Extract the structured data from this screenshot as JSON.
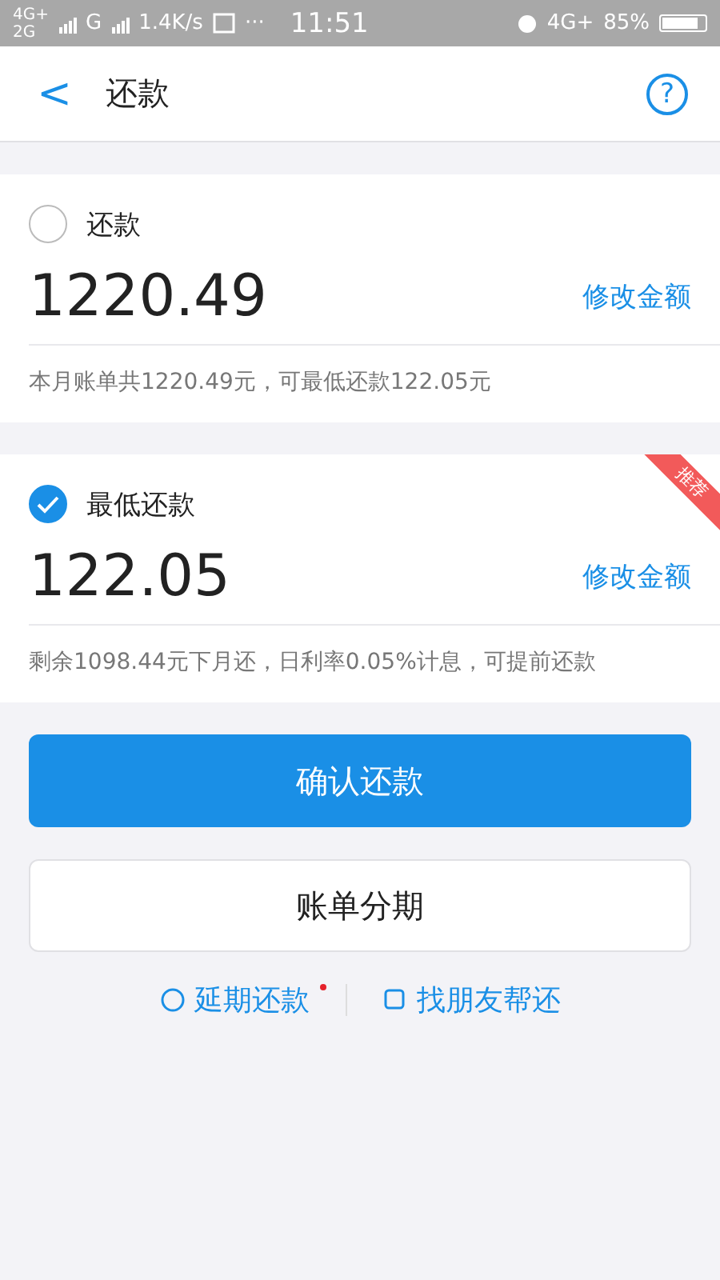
{
  "status_bar": {
    "network_1": "4G+",
    "network_2": "2G",
    "network_3": "G",
    "speed": "1.4K/s",
    "more": "···",
    "time": "11:51",
    "network_right": "4G+",
    "battery": "85%"
  },
  "header": {
    "back": "<",
    "title": "还款",
    "help": "?"
  },
  "options": [
    {
      "label": "还款",
      "selected": false,
      "amount": "1220.49",
      "edit": "修改金额",
      "note": "本月账单共1220.49元，可最低还款122.05元"
    },
    {
      "label": "最低还款",
      "selected": true,
      "badge": "推荐",
      "amount": "122.05",
      "edit": "修改金额",
      "note": "剩余1098.44元下月还，日利率0.05%计息，可提前还款"
    }
  ],
  "confirm_button": "确认还款",
  "installment_button": "账单分期",
  "links": [
    {
      "label": "延期还款",
      "dot": true
    },
    {
      "label": "找朋友帮还",
      "dot": false
    }
  ]
}
